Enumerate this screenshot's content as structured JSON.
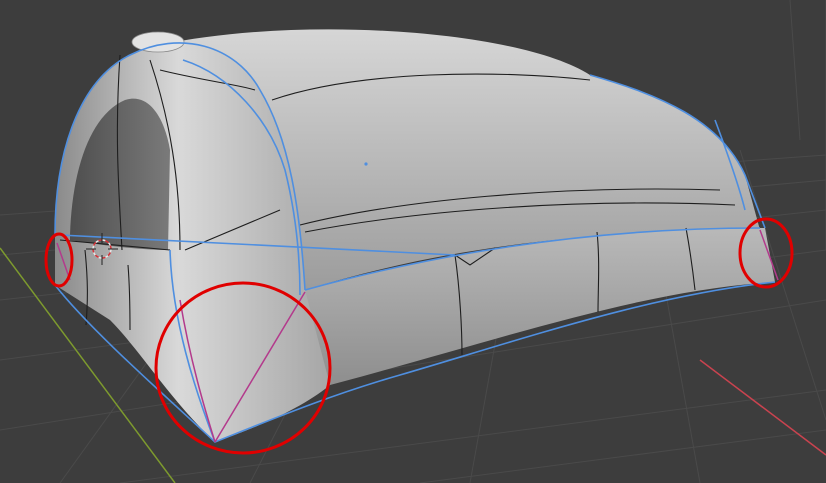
{
  "viewport": {
    "background": "#3d3d3d",
    "grid_color": "#4a4a4a",
    "x_axis_color": "#c9434f",
    "y_axis_color": "#7d9a2e"
  },
  "model": {
    "surface_light": "#d2d2d2",
    "surface_mid": "#a9a9a9",
    "surface_dark": "#6e6e6e",
    "boundary_edge_color": "#4f8fe0",
    "seam_edge_color": "#b33a8c",
    "wire_color": "#1e1e1e"
  },
  "annotations": {
    "circle_color": "#e00000",
    "circles": [
      {
        "name": "left-corner-circle"
      },
      {
        "name": "front-corner-circle"
      },
      {
        "name": "right-corner-circle"
      }
    ]
  },
  "cursor_icon": "3d-cursor-icon"
}
